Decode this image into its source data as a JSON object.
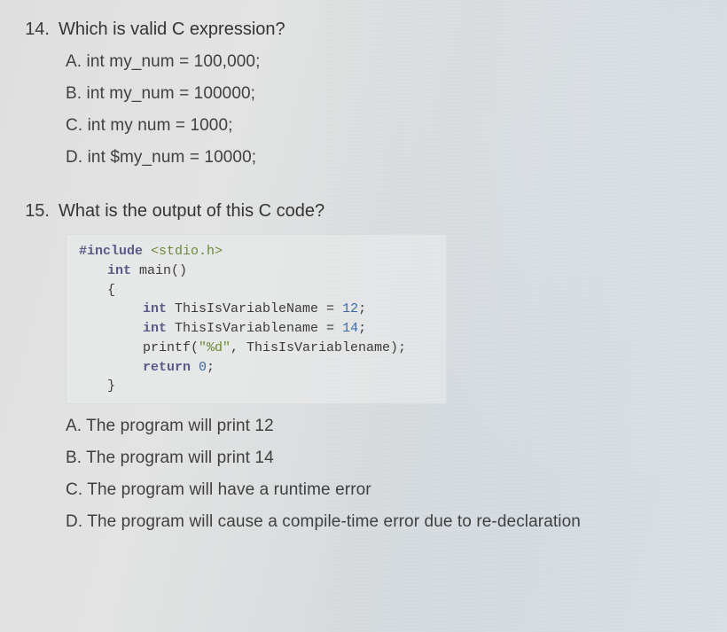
{
  "questions": [
    {
      "number": "14.",
      "text": "Which is valid C expression?",
      "options": [
        "A. int my_num = 100,000;",
        "B. int my_num = 100000;",
        "C. int my num = 1000;",
        "D. int $my_num = 10000;"
      ]
    },
    {
      "number": "15.",
      "text": "What is the output of this C code?",
      "code": {
        "l1a": "#include",
        "l1b": " <stdio.h>",
        "l2a": "int",
        "l2b": " main()",
        "l3": "{",
        "l4a": "int",
        "l4b": " ThisIsVariableName = ",
        "l4c": "12",
        "l4d": ";",
        "l5a": "int",
        "l5b": " ThisIsVariablename = ",
        "l5c": "14",
        "l5d": ";",
        "l6a": "printf(",
        "l6b": "\"%d\"",
        "l6c": ", ThisIsVariablename);",
        "l7a": "return",
        "l7b": " ",
        "l7c": "0",
        "l7d": ";",
        "l8": "}"
      },
      "options": [
        "A. The program will print 12",
        "B. The program will print 14",
        "C. The program will have a runtime error",
        "D. The program will cause a compile-time error due to re-declaration"
      ]
    }
  ]
}
